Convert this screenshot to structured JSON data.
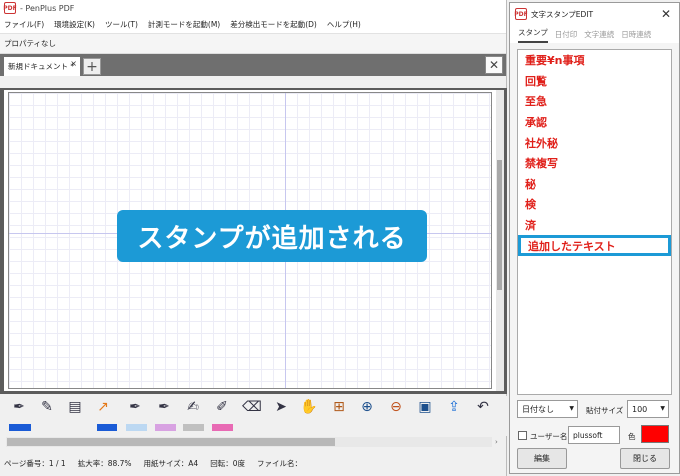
{
  "app": {
    "title": "- PenPlus PDF",
    "icon_text": "PDF"
  },
  "menu": [
    "ファイル(F)",
    "環境設定(K)",
    "ツール(T)",
    "計測モードを起動(M)",
    "差分検出モードを起動(D)",
    "ヘルプ(H)"
  ],
  "properties": {
    "label": "プロパティなし"
  },
  "tabs": {
    "doc_label": "新規ドキュメント *",
    "close": "×",
    "add": "+",
    "close_doc": "✕"
  },
  "canvas": {
    "banner": "スタンプが追加される"
  },
  "toolbar": {
    "icons": [
      "pen-icon",
      "note-icon",
      "page-icon",
      "resize-icon",
      "pen-add-icon",
      "pen-edit-icon",
      "brush-icon",
      "stamp-icon",
      "eraser-icon",
      "pointer-icon",
      "hand-icon",
      "select-icon",
      "zoom-in-icon",
      "zoom-out-icon",
      "page-fit-icon",
      "export-icon",
      "undo-icon"
    ],
    "swatches": [
      "#1a5bd6",
      "#1a5bd6",
      "#bcd8f2",
      "#d8a2e2",
      "#c0c0c0",
      "#e86ab4"
    ]
  },
  "status": {
    "page": "ページ番号：1 / 1",
    "zoom": "拡大率：88.7%",
    "paper": "用紙サイズ：A4",
    "rotation": "回転：0度",
    "filename": "ファイル名："
  },
  "dialog": {
    "title": "文字スタンプEDIT",
    "close": "✕",
    "icon_text": "PDF",
    "tabs": [
      "スタンプ",
      "日付印",
      "文字連続",
      "日時連続"
    ],
    "items": [
      "重要¥n事項",
      "回覧",
      "至急",
      "承認",
      "社外秘",
      "禁複写",
      "秘",
      "検",
      "済",
      "追加したテキスト"
    ],
    "date_select": "日付なし",
    "size_label": "貼付サイズ",
    "size_value": "100",
    "user_label": "ユーザー名",
    "user_value": "plussoft",
    "color_label": "色",
    "stamp_color": "#ff0000",
    "edit_button": "編集",
    "close_button": "閉じる"
  }
}
